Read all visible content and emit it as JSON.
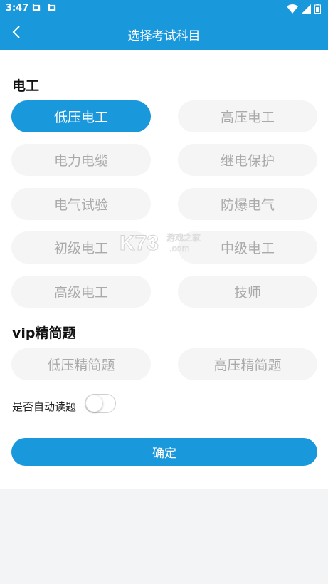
{
  "status": {
    "time": "3:47"
  },
  "header": {
    "title": "选择考试科目"
  },
  "sections": {
    "electrician": {
      "title": "电工",
      "chips": [
        "低压电工",
        "高压电工",
        "电力电缆",
        "继电保护",
        "电气试验",
        "防爆电气",
        "初级电工",
        "中级电工",
        "高级电工",
        "技师"
      ],
      "selected": "低压电工"
    },
    "vip": {
      "title": "vip精简题",
      "chips": [
        "低压精简题",
        "高压精简题"
      ]
    }
  },
  "auto_read": {
    "label": "是否自动读题",
    "enabled": false
  },
  "confirm": {
    "label": "确定"
  },
  "colors": {
    "accent": "#1a98dc",
    "chip_bg": "#f5f5f5",
    "chip_text": "#aaaaaa"
  },
  "watermark": {
    "text": "K73 游戏之家 .com"
  }
}
